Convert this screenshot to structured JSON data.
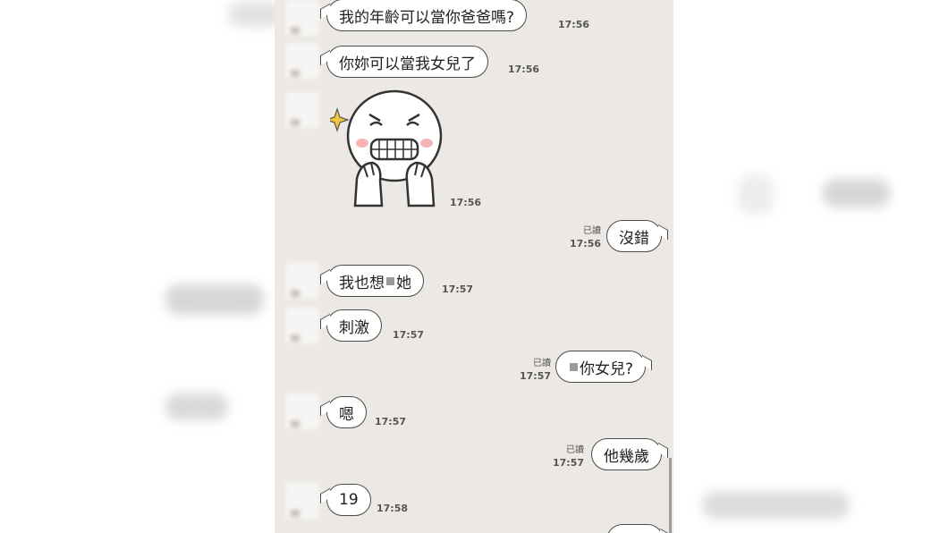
{
  "colors": {
    "chat_bg": "#ece9e5",
    "bubble_border": "#4a4a4a",
    "sticker_star": "#f5c542"
  },
  "messages": [
    {
      "side": "left",
      "text": "我的年齡可以當你爸爸嗎?",
      "time": "17:56"
    },
    {
      "side": "left",
      "text": "你妳可以當我女兒了",
      "time": "17:56"
    },
    {
      "side": "left",
      "sticker": "grinning-face-hands-on-cheeks",
      "time": "17:56"
    },
    {
      "side": "right",
      "text": "沒錯",
      "read": "已讀",
      "time": "17:56"
    },
    {
      "side": "left",
      "text_before": "我也想",
      "text_after": "她",
      "time": "17:57"
    },
    {
      "side": "left",
      "text": "刺激",
      "time": "17:57"
    },
    {
      "side": "right",
      "text": "你女兒?",
      "read": "已讀",
      "time": "17:57"
    },
    {
      "side": "left",
      "text": "嗯",
      "time": "17:57"
    },
    {
      "side": "right",
      "text": "他幾歲",
      "read": "已讀",
      "time": "17:57"
    },
    {
      "side": "left",
      "text": "19",
      "time": "17:58"
    }
  ]
}
